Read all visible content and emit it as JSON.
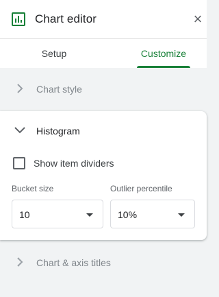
{
  "header": {
    "title": "Chart editor",
    "icon": "chart-icon",
    "close_label": "×",
    "accent_color": "#188038"
  },
  "tabs": [
    {
      "label": "Setup",
      "active": false
    },
    {
      "label": "Customize",
      "active": true
    }
  ],
  "sections": {
    "chart_style": {
      "label": "Chart style",
      "expanded": false
    },
    "histogram": {
      "label": "Histogram",
      "expanded": true,
      "show_item_dividers": {
        "label": "Show item dividers",
        "checked": false
      },
      "bucket_size": {
        "label": "Bucket size",
        "value": "10"
      },
      "outlier_percentile": {
        "label": "Outlier percentile",
        "value": "10%"
      }
    },
    "chart_axis_titles": {
      "label": "Chart & axis titles",
      "expanded": false
    }
  }
}
